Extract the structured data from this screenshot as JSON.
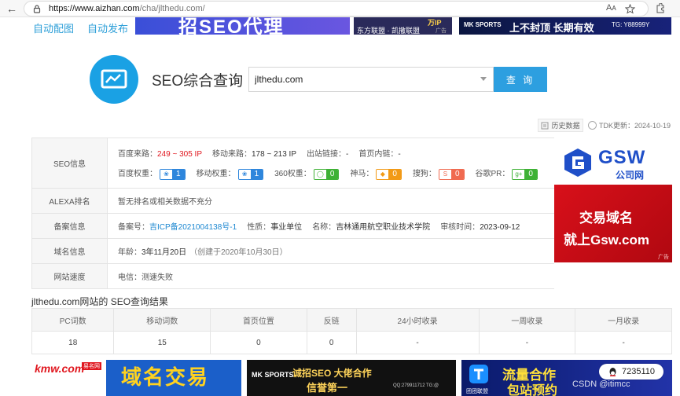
{
  "browser": {
    "url_host": "https://www.aizhan.com",
    "url_path": "/cha/jlthedu.com/",
    "reader_label": "Aᴀ"
  },
  "top_links": [
    "自动配图",
    "自动发布"
  ],
  "top_ads": {
    "ad1_text": "招SEO代理",
    "ad2_line1": "东方联盟 · 凯撒联盟",
    "ad2_line2": "万IP",
    "ad2_corner": "广告",
    "ad3_logo": "MK SPORTS",
    "ad3_slogan": "上不封顶 长期有效",
    "ad3_tg": "TG: Y88999Y"
  },
  "hero": {
    "title": "SEO综合查询",
    "search_value": "jlthedu.com",
    "search_button": "查 询"
  },
  "meta": {
    "history_label": "历史数据",
    "tdk_label": "TDK更新：2024-10-19"
  },
  "seo_info": {
    "label": "SEO信息",
    "baidu_source_label": "百度来路：",
    "baidu_source_value": "249 ~ 305 IP",
    "mobile_source_label": "移动来路：",
    "mobile_source_value": "178 ~ 213 IP",
    "outlinks_label": "出站链接：",
    "outlinks_value": "-",
    "inner_links_label": "首页内链：",
    "inner_links_value": "-",
    "ranks": [
      {
        "label": "百度权重：",
        "value": "1",
        "color": "#2e86dc",
        "icon": "paw-icon"
      },
      {
        "label": "移动权重：",
        "value": "1",
        "color": "#2e86dc",
        "icon": "paw-icon"
      },
      {
        "label": "360权重：",
        "value": "0",
        "color": "#3eb135",
        "icon": "360-icon"
      },
      {
        "label": "神马：",
        "value": "0",
        "color": "#f29a16",
        "icon": "shenma-icon"
      },
      {
        "label": "搜狗：",
        "value": "0",
        "color": "#f06a50",
        "icon": "sogou-icon"
      },
      {
        "label": "谷歌PR：",
        "value": "0",
        "color": "#3eb135",
        "icon": "google-icon"
      }
    ]
  },
  "alexa": {
    "label": "ALEXA排名",
    "value": "暂无排名或相关数据不充分"
  },
  "beian": {
    "label": "备案信息",
    "number_label": "备案号：",
    "number_value": "吉ICP备2021004138号-1",
    "nature_label": "性质：",
    "nature_value": "事业单位",
    "name_label": "名称：",
    "name_value": "吉林通用航空职业技术学院",
    "audit_label": "审核时间：",
    "audit_value": "2023-09-12"
  },
  "domain": {
    "label": "域名信息",
    "age_label": "年龄：",
    "age_value": "3年11月20日",
    "created": "（创建于2020年10月30日）"
  },
  "speed": {
    "label": "网站速度",
    "value": "电信：测速失败"
  },
  "gsw_ad": {
    "brand": "GSW",
    "brand_sub": "公司网",
    "line1": "交易域名",
    "line2": "就上Gsw.com",
    "corner": "广告"
  },
  "results": {
    "title": "jlthedu.com网站的 SEO查询结果",
    "headers": [
      "PC词数",
      "移动词数",
      "首页位置",
      "反链",
      "24小时收录",
      "一周收录",
      "一月收录"
    ],
    "row": [
      "18",
      "15",
      "0",
      "0",
      "-",
      "-",
      "-"
    ]
  },
  "bottom_ads": {
    "ad1_logo": "kmw.com",
    "ad1_logo_tag": "易名网",
    "ad1_text": "域名交易",
    "ad2_logo": "MK SPORTS",
    "ad2_text": "诚招SEO 大佬合作",
    "ad2_sub": "信誉第一",
    "ad2_phone": "QQ:279911712",
    "ad2_tg": "TG:@",
    "ad3_logo": "团团联盟",
    "ad3_text1": "流量合作",
    "ad3_text2": "包站预约"
  },
  "qq_pill": {
    "number": "7235110"
  },
  "watermark": {
    "text": "CSDN @itimcc"
  }
}
